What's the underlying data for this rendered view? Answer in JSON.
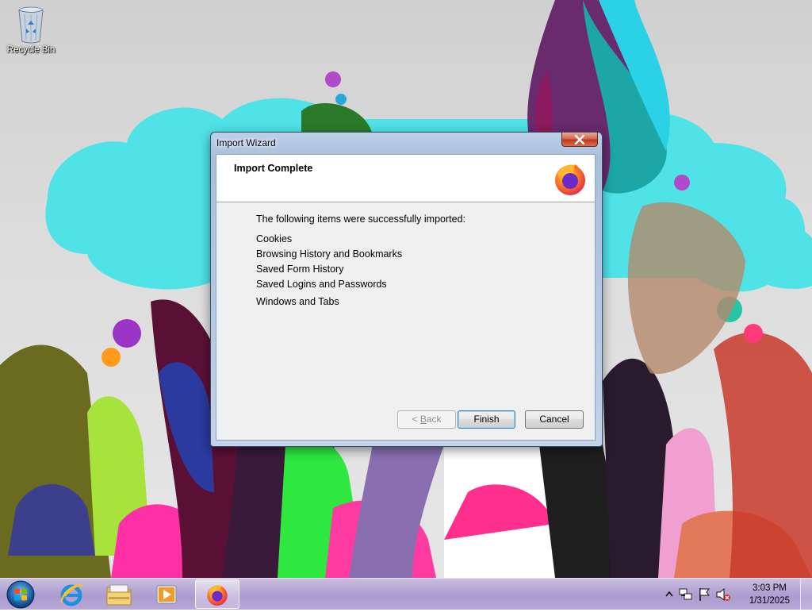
{
  "desktop": {
    "icons": [
      {
        "label": "Recycle Bin",
        "icon": "recycle-bin-icon"
      }
    ]
  },
  "window": {
    "title": "Import Wizard",
    "close_icon": "close-icon",
    "header": {
      "title": "Import Complete",
      "logo": "firefox-logo-icon"
    },
    "intro": "The following items were successfully imported:",
    "items": [
      "Cookies",
      "Browsing History and Bookmarks",
      "Saved Form History",
      "Saved Logins and Passwords",
      "Windows and Tabs"
    ],
    "buttons": {
      "back_prefix": "< ",
      "back_accel": "B",
      "back_suffix": "ack",
      "finish": "Finish",
      "cancel": "Cancel"
    }
  },
  "taskbar": {
    "start_icon": "windows-start-icon",
    "pinned": [
      {
        "name": "internet-explorer-icon",
        "active": false
      },
      {
        "name": "file-explorer-icon",
        "active": false
      },
      {
        "name": "media-player-icon",
        "active": false
      },
      {
        "name": "firefox-icon",
        "active": true
      }
    ],
    "tray": {
      "icons": [
        "show-hidden-icons-chevron-icon",
        "network-icon",
        "action-center-flag-icon",
        "volume-muted-icon"
      ],
      "time": "3:03 PM",
      "date": "1/31/2025"
    }
  },
  "colors": {
    "taskbar": "#b6a7d5",
    "window_frame": "#b6c9e2",
    "close_button": "#c2381c",
    "dialog_bg": "#f0f0f0"
  }
}
